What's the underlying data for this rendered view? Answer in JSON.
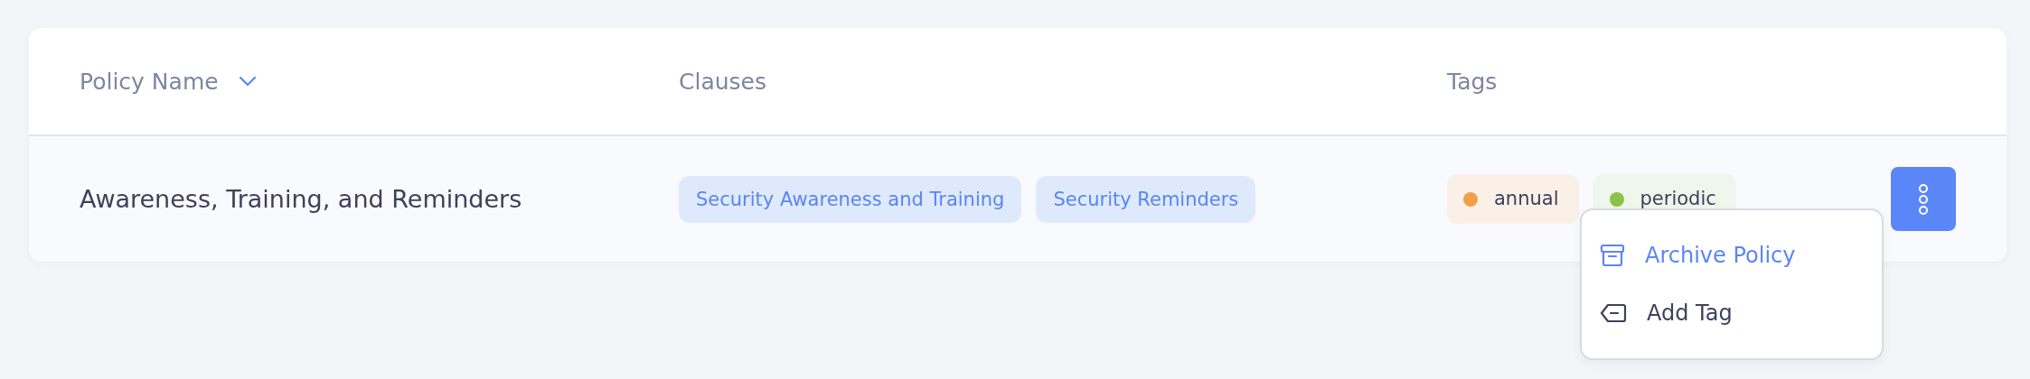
{
  "table": {
    "columns": [
      {
        "label": "Policy Name",
        "sortable": true
      },
      {
        "label": "Clauses",
        "sortable": false
      },
      {
        "label": "Tags",
        "sortable": false
      }
    ],
    "rows": [
      {
        "name": "Awareness, Training, and Reminders",
        "clauses": [
          "Security Awareness and Training",
          "Security Reminders"
        ],
        "tags": [
          {
            "label": "annual",
            "color": "#f0a04b"
          },
          {
            "label": "periodic",
            "color": "#8bc34a"
          }
        ]
      }
    ]
  },
  "menu": {
    "items": [
      {
        "label": "Archive Policy",
        "kind": "archive",
        "selected": true
      },
      {
        "label": "Add Tag",
        "kind": "tag",
        "selected": false
      }
    ]
  }
}
